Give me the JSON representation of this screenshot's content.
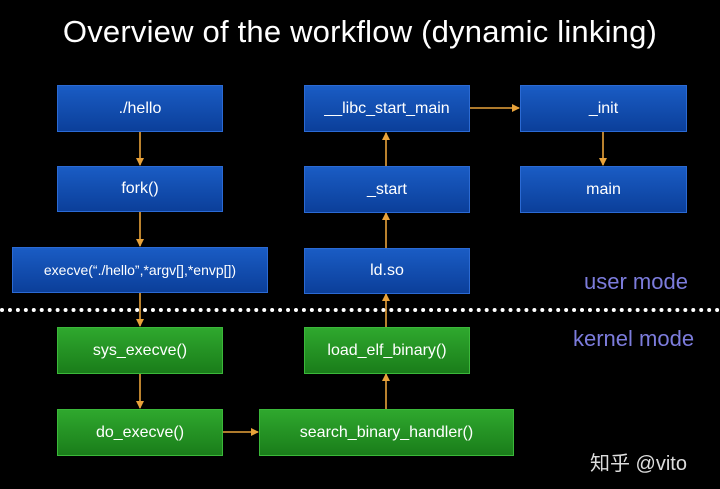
{
  "title": "Overview of the workflow (dynamic linking)",
  "boxes": {
    "hello": "./hello",
    "fork": "fork()",
    "execve": "execve(“./hello”,*argv[],*envp[])",
    "sys_execve": "sys_execve()",
    "do_execve": "do_execve()",
    "search_binary_handler": "search_binary_handler()",
    "load_elf_binary": "load_elf_binary()",
    "ld_so": "ld.so",
    "start": "_start",
    "libc_start_main": "__libc_start_main",
    "init": "_init",
    "main": "main"
  },
  "modes": {
    "user": "user mode",
    "kernel": "kernel mode"
  },
  "watermark": "知乎 @vito",
  "colors": {
    "user_box": "#0f4aa8",
    "kernel_box": "#22911f",
    "arrow": "#e8a23a",
    "mode_label": "#7c7cdc",
    "background": "#000000"
  }
}
